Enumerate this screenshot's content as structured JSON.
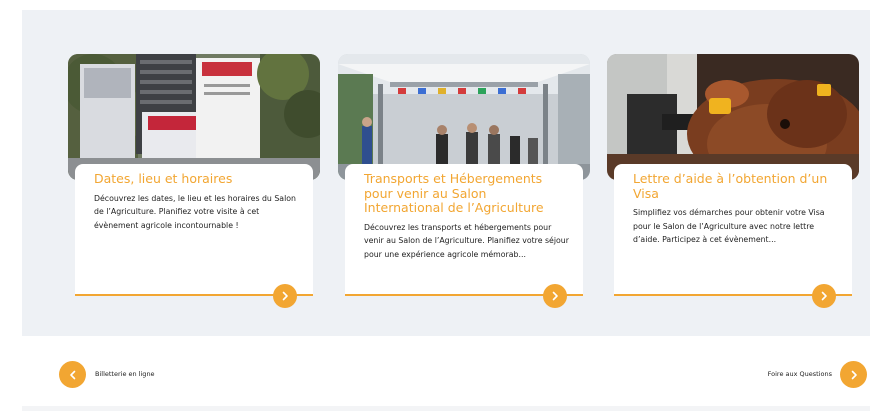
{
  "cards": [
    {
      "title": "Dates, lieu et horaires",
      "description": "Découvrez les dates, le lieu et les horaires du Salon de l’Agriculture. Planifiez votre visite à cet évènement agricole incontournable !",
      "image": "salon-building-photo"
    },
    {
      "title": "Transports et Hébergements pour venir au Salon International de l’Agriculture",
      "description": "Découvrez les transports et hébergements pour venir au Salon de l’Agriculture. Planifiez votre séjour pour une expérience agricole mémorab...",
      "image": "visitors-walkway-photo"
    },
    {
      "title": "Lettre d’aide à l’obtention d’un Visa",
      "description": "Simplifiez vos démarches pour obtenir votre Visa pour le Salon de l’Agriculture avec notre lettre d’aide. Participez à cet évènement...",
      "image": "cow-with-ear-tag-photo"
    }
  ],
  "nav": {
    "prev_label": "Billetterie en ligne",
    "next_label": "Foire aux Questions"
  },
  "colors": {
    "accent": "#f2a632",
    "band_background": "#eef1f5",
    "card_background": "#ffffff",
    "text": "#1e1e1e"
  },
  "icons": {
    "card_button": "chevron-right-icon",
    "prev_button": "chevron-left-icon",
    "next_button": "chevron-right-icon"
  }
}
